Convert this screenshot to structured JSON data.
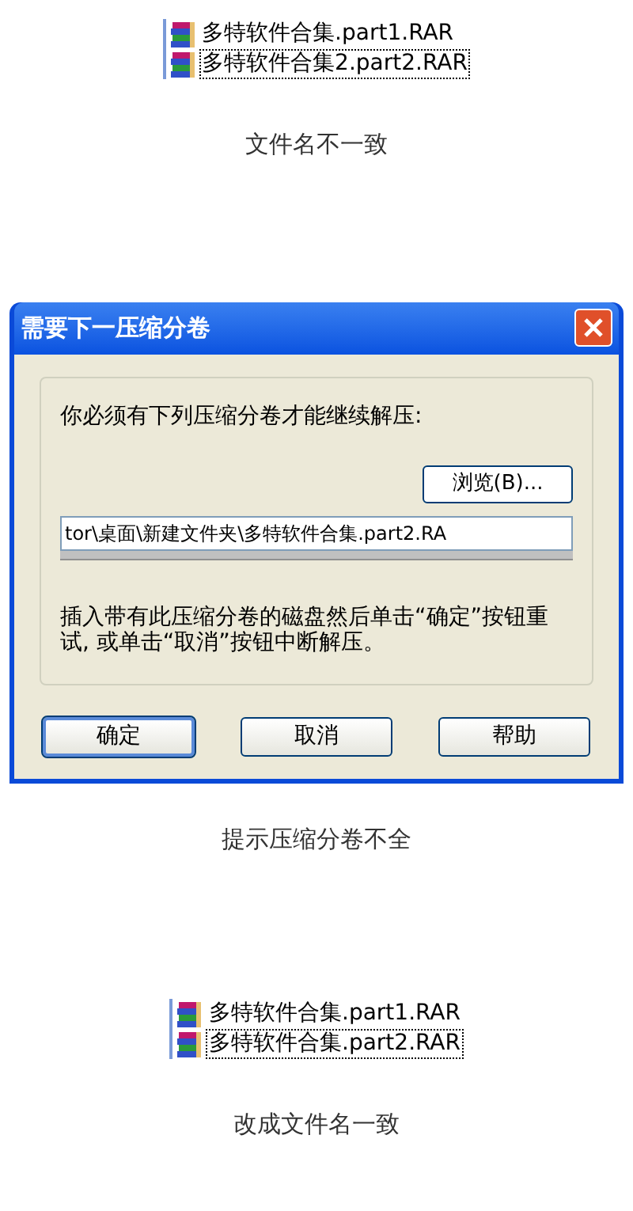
{
  "panels": [
    {
      "kind": "files",
      "files": [
        {
          "name": "多特软件合集.part1.RAR",
          "selected": false
        },
        {
          "name": "多特软件合集2.part2.RAR",
          "selected": true
        }
      ],
      "caption": "文件名不一致"
    },
    {
      "kind": "dialog",
      "title": "需要下一压缩分卷",
      "message": "你必须有下列压缩分卷才能继续解压:",
      "browse_button": "浏览(B)...",
      "path": "tor\\桌面\\新建文件夹\\多特软件合集.part2.RA",
      "hint": "插入带有此压缩分卷的磁盘然后单击“确定”按钮重试, 或单击“取消”按钮中断解压。",
      "buttons": [
        {
          "label": "确定",
          "selected": true
        },
        {
          "label": "取消",
          "selected": false
        },
        {
          "label": "帮助",
          "selected": false
        }
      ],
      "caption": "提示压缩分卷不全"
    },
    {
      "kind": "files",
      "files": [
        {
          "name": "多特软件合集.part1.RAR",
          "selected": false
        },
        {
          "name": "多特软件合集.part2.RAR",
          "selected": true
        }
      ],
      "caption": "改成文件名一致"
    }
  ]
}
